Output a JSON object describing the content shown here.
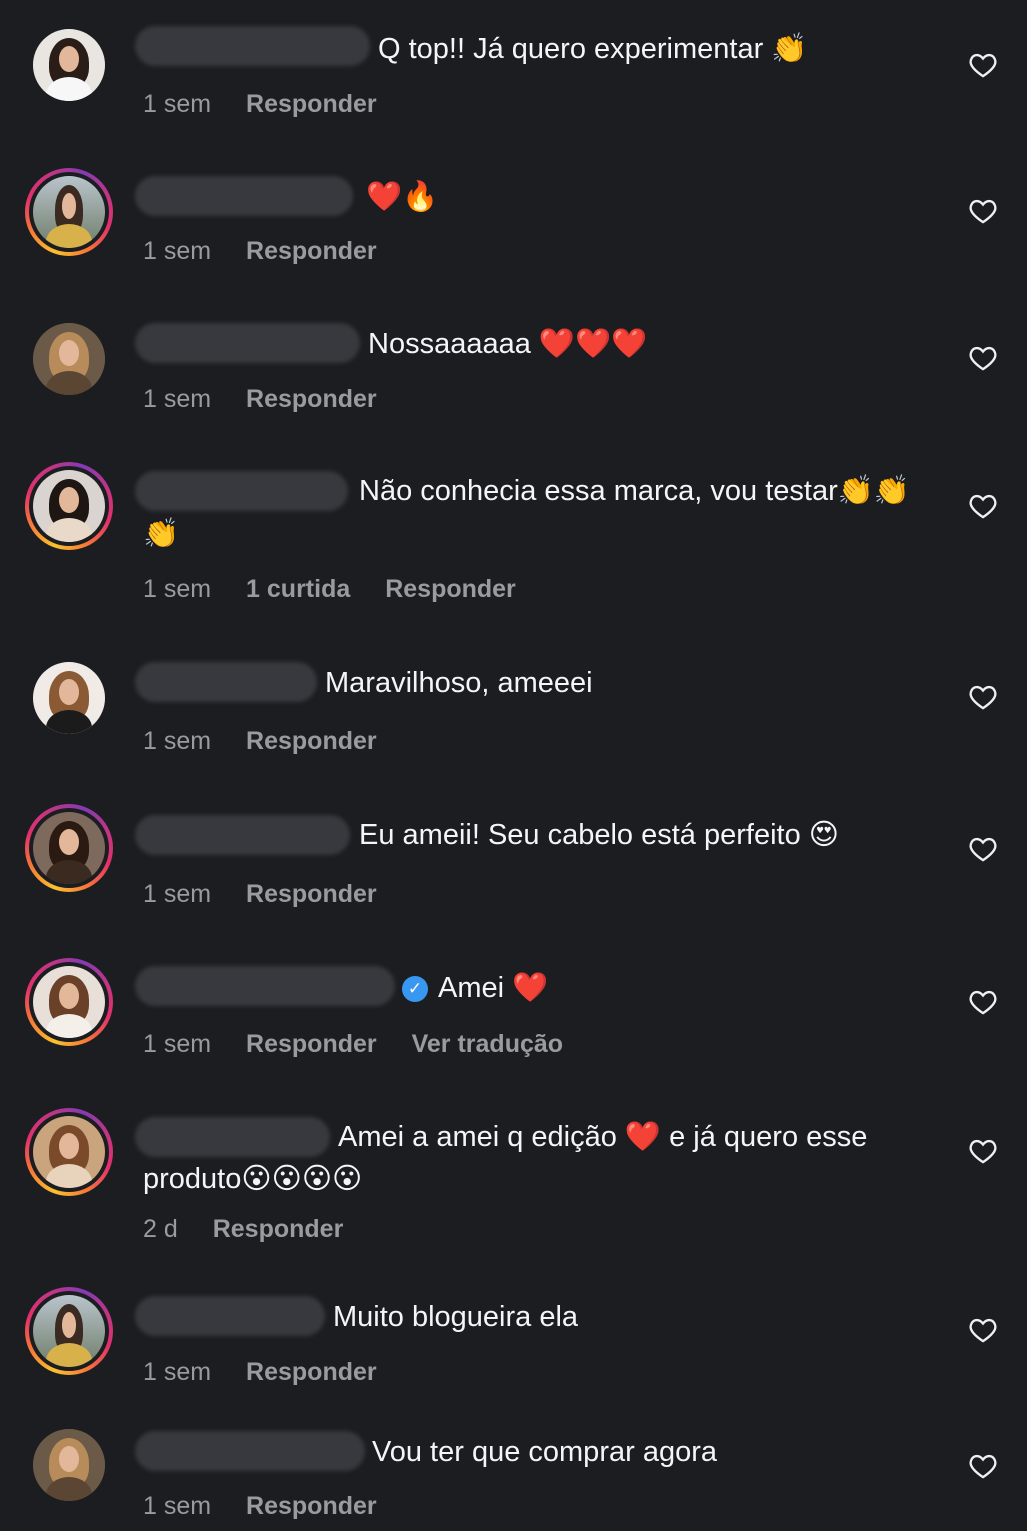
{
  "comments": [
    {
      "text": "Q top!! Já quero experimentar 👏",
      "time": "1 sem",
      "reply": "Responder"
    },
    {
      "text": "❤️🔥",
      "time": "1 sem",
      "reply": "Responder"
    },
    {
      "text": "Nossaaaaaa ❤️❤️❤️",
      "time": "1 sem",
      "reply": "Responder"
    },
    {
      "text": "Não conhecia essa marca, vou testar👏👏",
      "text2": "👏",
      "time": "1 sem",
      "likes": "1 curtida",
      "reply": "Responder"
    },
    {
      "text": "Maravilhoso, ameeei",
      "time": "1 sem",
      "reply": "Responder"
    },
    {
      "text": "Eu ameii! Seu cabelo está perfeito 😍",
      "time": "1 sem",
      "reply": "Responder"
    },
    {
      "text": "Amei ❤️",
      "time": "1 sem",
      "reply": "Responder",
      "translate": "Ver tradução"
    },
    {
      "text": "Amei a amei q edição ❤️ e já quero esse",
      "text2": "produto😮😮😮😮",
      "time": "2 d",
      "reply": "Responder"
    },
    {
      "text": "Muito blogueira ela",
      "time": "1 sem",
      "reply": "Responder"
    },
    {
      "text": "Vou ter que comprar agora",
      "time": "1 sem",
      "reply": "Responder"
    }
  ],
  "icons": {
    "like": "heart-outline-icon",
    "verified": "verified-badge-icon"
  }
}
